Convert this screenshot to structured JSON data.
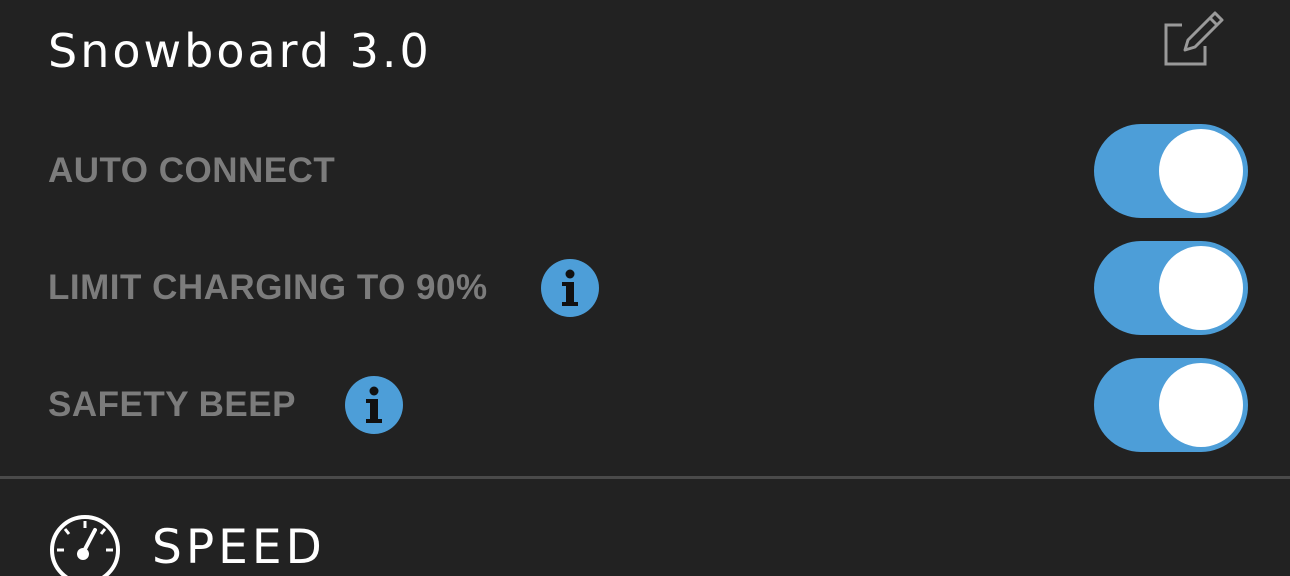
{
  "device": {
    "title": "Snowboard 3.0",
    "edit_icon": "edit-icon"
  },
  "settings": [
    {
      "label": "AUTO CONNECT",
      "has_info": false,
      "enabled": true
    },
    {
      "label": "LIMIT CHARGING TO 90%",
      "has_info": true,
      "enabled": true
    },
    {
      "label": "SAFETY BEEP",
      "has_info": true,
      "enabled": true
    }
  ],
  "speed_section": {
    "label": "SPEED",
    "icon": "speedometer-icon"
  },
  "colors": {
    "background": "#222222",
    "accent": "#4d9ed8",
    "label": "#7c7c7c",
    "title": "#ffffff",
    "divider": "#4a4a4a"
  }
}
